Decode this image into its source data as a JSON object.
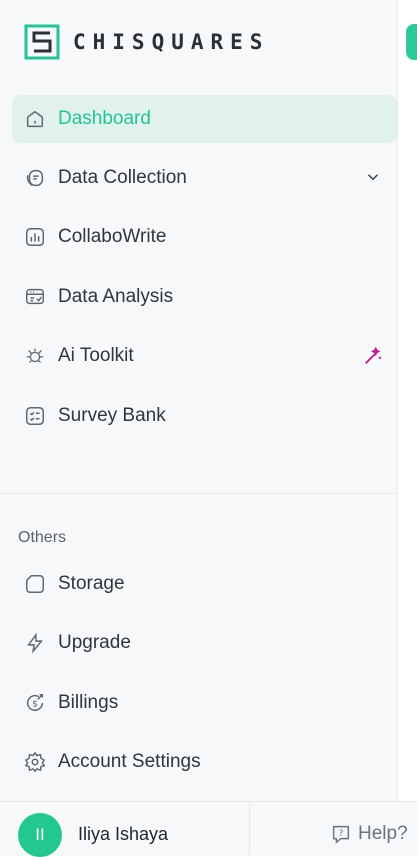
{
  "brand": {
    "name": "CHISQUARES",
    "accent": "#22c594",
    "active_bg": "#e1f1ec"
  },
  "nav": {
    "dashboard": "Dashboard",
    "data_collection": "Data Collection",
    "collabowrite": "CollaboWrite",
    "data_analysis": "Data Analysis",
    "ai_toolkit": "Ai Toolkit",
    "survey_bank": "Survey Bank"
  },
  "others": {
    "heading": "Others",
    "storage": "Storage",
    "upgrade": "Upgrade",
    "billings": "Billings",
    "account_settings": "Account Settings"
  },
  "user": {
    "initials": "II",
    "name": "Iliya Ishaya"
  },
  "help": {
    "label": "Help?"
  },
  "icons": [
    "home-icon",
    "data-collection-icon",
    "chevron-down-icon",
    "chart-icon",
    "data-analysis-icon",
    "ai-bug-icon",
    "magic-wand-icon",
    "checklist-icon",
    "folder-icon",
    "bolt-icon",
    "dollar-refresh-icon",
    "gear-icon",
    "help-icon"
  ]
}
